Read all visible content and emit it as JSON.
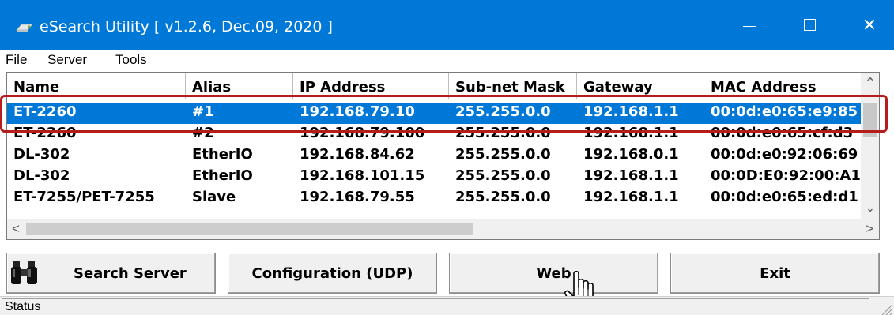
{
  "window": {
    "title": "eSearch Utility [ v1.2.6, Dec.09, 2020 ]",
    "close_glyph": "✕",
    "accent_color": "#0078d7",
    "highlight_color": "#b71c1c"
  },
  "menu": {
    "items": [
      "File",
      "Server",
      "Tools"
    ]
  },
  "table": {
    "columns": [
      "Name",
      "Alias",
      "IP Address",
      "Sub-net Mask",
      "Gateway",
      "MAC Address"
    ],
    "rows": [
      [
        "ET-2260",
        "#1",
        "192.168.79.10",
        "255.255.0.0",
        "192.168.1.1",
        "00:0d:e0:65:e9:85"
      ],
      [
        "ET-2260",
        "#2",
        "192.168.79.100",
        "255.255.0.0",
        "192.168.1.1",
        "00:0d:e0:65:cf:d3"
      ],
      [
        "DL-302",
        "EtherIO",
        "192.168.84.62",
        "255.255.0.0",
        "192.168.0.1",
        "00:0d:e0:92:06:69"
      ],
      [
        "DL-302",
        "EtherIO",
        "192.168.101.15",
        "255.255.0.0",
        "192.168.1.1",
        "00:0D:E0:92:00:A1"
      ],
      [
        "ET-7255/PET-7255",
        "Slave",
        "192.168.79.55",
        "255.255.0.0",
        "192.168.1.1",
        "00:0d:e0:65:ed:d1"
      ]
    ],
    "selected_row": 0
  },
  "scrollbars": {
    "up": "^",
    "down": "⌄",
    "left": "<",
    "right": ">"
  },
  "buttons": {
    "search": "Search Server",
    "config": "Configuration (UDP)",
    "web": "Web",
    "exit": "Exit"
  },
  "icons": {
    "app": "network-card-icon",
    "search": "binoculars-icon",
    "pointer": "hand-cursor-icon"
  },
  "status": {
    "text": "Status"
  }
}
